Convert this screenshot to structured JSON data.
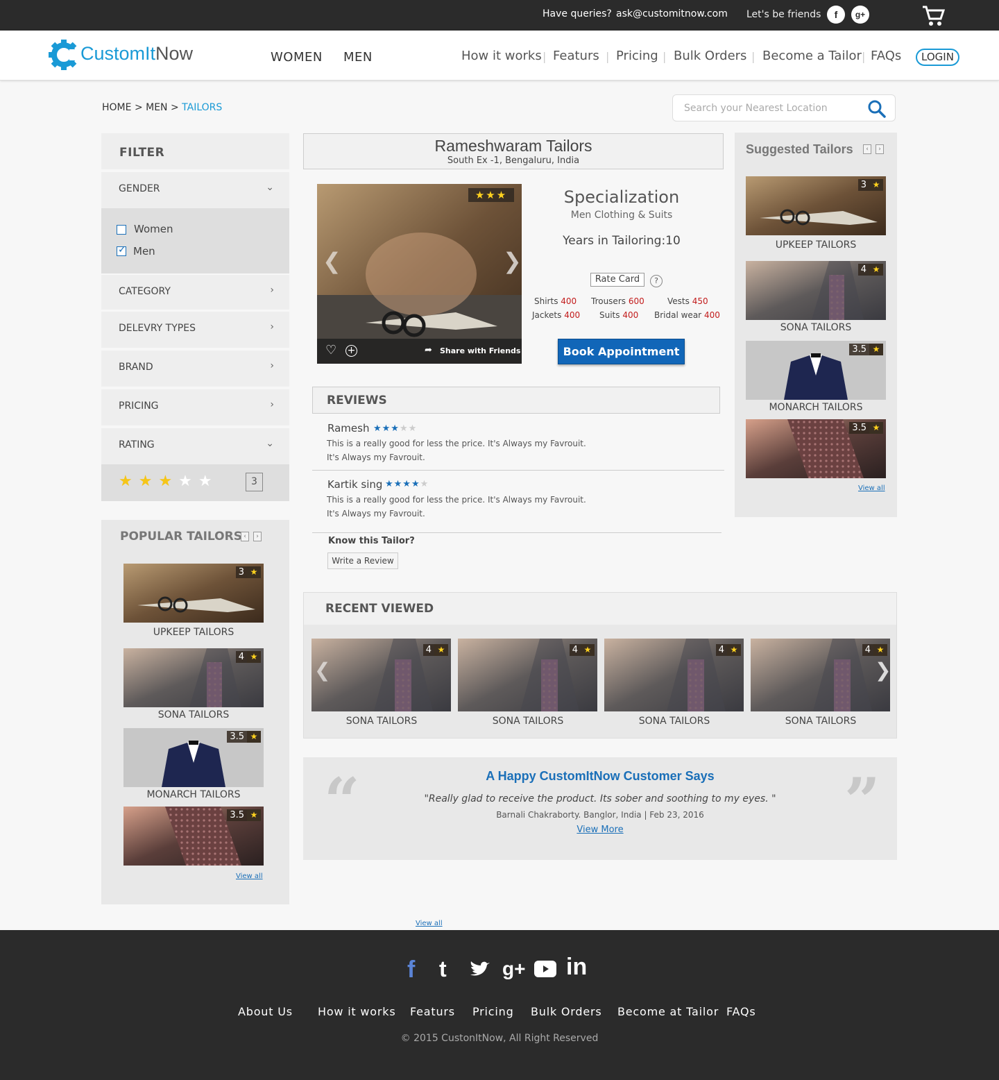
{
  "topbar": {
    "queries_label": "Have queries?",
    "email": "ask@customitnow.com",
    "friends_label": "Let's be friends",
    "facebook_icon": "f",
    "gplus_icon": "g+"
  },
  "brand": {
    "name_part1": "CustomIt",
    "name_part2": "Now",
    "accent": "#1a9ad6"
  },
  "gender_nav": [
    {
      "label": "WOMEN"
    },
    {
      "label": "MEN"
    }
  ],
  "main_nav": [
    {
      "label": "How it works"
    },
    {
      "label": "Featurs"
    },
    {
      "label": "Pricing"
    },
    {
      "label": "Bulk Orders"
    },
    {
      "label": "Become a Tailor"
    },
    {
      "label": "FAQs"
    }
  ],
  "login_label": "LOGIN",
  "breadcrumb": {
    "home": "HOME",
    "sep": ">",
    "men": "MEN",
    "current": "TAILORS"
  },
  "search": {
    "placeholder": "Search your Nearest Location"
  },
  "filter": {
    "title": "FILTER",
    "gender": {
      "label": "GENDER",
      "options": [
        {
          "label": "Women",
          "checked": false
        },
        {
          "label": "Men",
          "checked": true
        }
      ]
    },
    "sections": [
      {
        "label": "CATEGORY"
      },
      {
        "label": "DELEVRY TYPES"
      },
      {
        "label": "BRAND"
      },
      {
        "label": "PRICING"
      }
    ],
    "rating": {
      "label": "RATING",
      "value": "3",
      "stars_filled": 3,
      "stars_total": 5
    }
  },
  "popular": {
    "title": "POPULAR TAILORS",
    "view_all": "View all",
    "items": [
      {
        "name": "UPKEEP TAILORS",
        "rating": "3"
      },
      {
        "name": "SONA TAILORS",
        "rating": "4"
      },
      {
        "name": "MONARCH TAILORS",
        "rating": "3.5"
      },
      {
        "name": "",
        "rating": "3.5"
      }
    ]
  },
  "tailor": {
    "name": "Rameshwaram Tailors",
    "address": "South Ex -1, Bengaluru, India",
    "hero_stars": 3,
    "share_label": "Share with Friends",
    "spec_title": "Specialization",
    "spec_value": "Men Clothing & Suits",
    "years": "Years in Tailoring:10",
    "rate_card": "Rate Card",
    "help": "?",
    "prices": [
      {
        "item": "Shirts",
        "price": "400"
      },
      {
        "item": "Trousers",
        "price": "600"
      },
      {
        "item": "Vests",
        "price": "450"
      },
      {
        "item": "Jackets",
        "price": "400"
      },
      {
        "item": "Suits",
        "price": "400"
      },
      {
        "item": "Bridal wear",
        "price": "400"
      }
    ],
    "book_label": "Book Appointment"
  },
  "reviews": {
    "title": "REVIEWS",
    "items": [
      {
        "name": "Ramesh",
        "stars": 3,
        "line1": "This is a really good for less the price. It's Always my Favrouit.",
        "line2": "It's Always my Favrouit."
      },
      {
        "name": "Kartik sing",
        "stars": 4,
        "line1": "This is a really good for less the price. It's Always my Favrouit.",
        "line2": "It's Always my Favrouit."
      }
    ],
    "know_label": "Know this Tailor?",
    "write_label": "Write a Review"
  },
  "suggested": {
    "title": "Suggested Tailors",
    "view_all": "View all",
    "items": [
      {
        "name": "UPKEEP TAILORS",
        "rating": "3"
      },
      {
        "name": "SONA TAILORS",
        "rating": "4"
      },
      {
        "name": "MONARCH TAILORS",
        "rating": "3.5"
      },
      {
        "name": "",
        "rating": "3.5"
      }
    ]
  },
  "recent": {
    "title": "RECENT VIEWED",
    "items": [
      {
        "name": "SONA TAILORS",
        "rating": "4"
      },
      {
        "name": "SONA TAILORS",
        "rating": "4"
      },
      {
        "name": "SONA TAILORS",
        "rating": "4"
      },
      {
        "name": "SONA TAILORS",
        "rating": "4"
      }
    ]
  },
  "testimonial": {
    "title": "A Happy CustomItNow Customer Says",
    "quote": "\"Really glad to receive the product. Its sober and soothing to my eyes. \"",
    "by": "Barnali Chakraborty. Banglor, India | Feb 23, 2016",
    "view_more": "View More"
  },
  "bottom_view_all": "View all",
  "footer": {
    "links": [
      {
        "label": "About Us"
      },
      {
        "label": "How it works"
      },
      {
        "label": "Featurs"
      },
      {
        "label": "Pricing"
      },
      {
        "label": "Bulk Orders"
      },
      {
        "label": "Become at Tailor"
      },
      {
        "label": "FAQs"
      }
    ],
    "copyright": "© 2015 CustonItNow, All Right Reserved",
    "social_icons": [
      "facebook-icon",
      "tumblr-icon",
      "twitter-icon",
      "google-plus-icon",
      "youtube-icon",
      "linkedin-icon"
    ]
  }
}
